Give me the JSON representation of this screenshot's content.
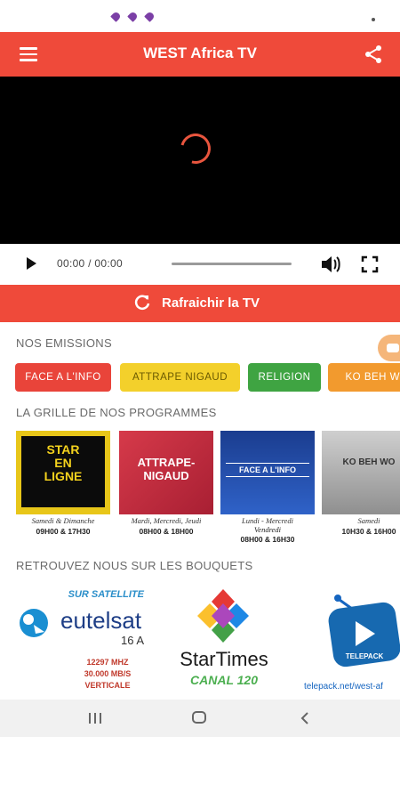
{
  "app": {
    "title": "WEST Africa TV"
  },
  "player": {
    "time": "00:00 / 00:00"
  },
  "refresh": {
    "label": "Rafraichir la TV"
  },
  "sections": {
    "emissions": "NOS EMISSIONS",
    "programmes": "LA GRILLE DE NOS PROGRAMMES",
    "bouquets": "RETROUVEZ NOUS SUR LES BOUQUETS"
  },
  "chips": [
    {
      "label": "FACE A L'INFO",
      "color": "#e9443a"
    },
    {
      "label": "ATTRAPE NIGAUD",
      "color": "#f3d02b"
    },
    {
      "label": "RELIGION",
      "color": "#3fa442"
    },
    {
      "label": "KO BEH WO",
      "color": "#f29a2e"
    }
  ],
  "programs": [
    {
      "image_text": [
        "STAR",
        "EN",
        "LIGNE"
      ],
      "line1": "Samedi & Dimanche",
      "line2": "09H00 & 17H30",
      "line3": ""
    },
    {
      "image_text": [
        "ATTRAPE-",
        "NIGAUD"
      ],
      "line1": "Mardi, Mercredi, Jeudi",
      "line2": "08H00 & 18H00",
      "line3": ""
    },
    {
      "image_text": [
        "FACE A L'INFO"
      ],
      "line1": "Lundi - Mercredi",
      "line2": "08H00 & 16H30",
      "line3": "Vendredi"
    },
    {
      "image_text": [
        "KO BEH WO"
      ],
      "line1": "Samedi",
      "line2": "10H30 & 16H00",
      "line3": ""
    }
  ],
  "bouquets": [
    {
      "heading": "SUR SATELLITE",
      "name": "eutelsat",
      "sub": "16 A",
      "details": [
        "12297 MHZ",
        "30.000 MB/S",
        "VERTICALE"
      ]
    },
    {
      "name": "StarTimes",
      "channel": "CANAL 120"
    },
    {
      "name": "TELEPACK",
      "url": "telepack.net/west-af"
    }
  ],
  "colors": {
    "primary": "#ef4a3a",
    "video_bg": "#000000",
    "nav_bg": "#f1f1f1"
  }
}
